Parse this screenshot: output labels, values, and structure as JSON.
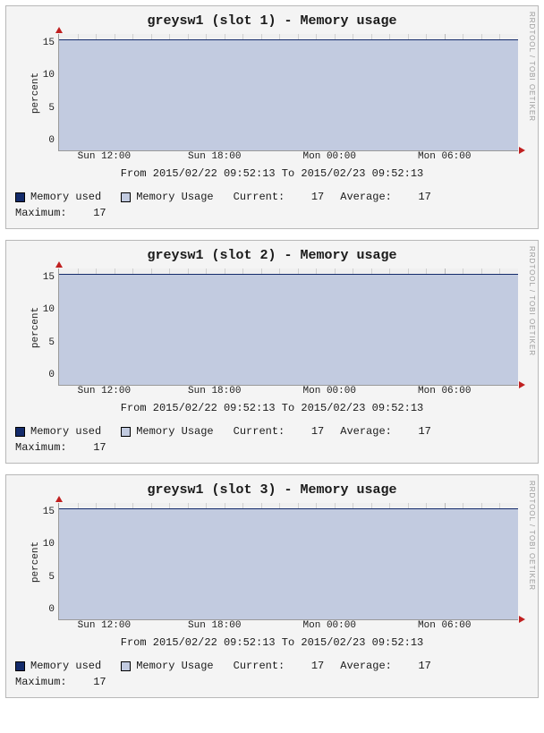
{
  "side_credit": "RRDTOOL / TOBI OETIKER",
  "panels": [
    {
      "title": "greysw1 (slot 1) - Memory usage",
      "ylabel": "percent",
      "yticks": [
        "0",
        "5",
        "10",
        "15"
      ],
      "xticks": [
        "Sun 12:00",
        "Sun 18:00",
        "Mon 00:00",
        "Mon 06:00"
      ],
      "caption": "From 2015/02/22 09:52:13 To 2015/02/23 09:52:13",
      "legend": {
        "used": "Memory used",
        "usage": "Memory Usage",
        "current_label": "Current:",
        "current_value": "17",
        "average_label": "Average:",
        "average_value": "17",
        "maximum_label": "Maximum:",
        "maximum_value": "17"
      }
    },
    {
      "title": "greysw1 (slot 2) - Memory usage",
      "ylabel": "percent",
      "yticks": [
        "0",
        "5",
        "10",
        "15"
      ],
      "xticks": [
        "Sun 12:00",
        "Sun 18:00",
        "Mon 00:00",
        "Mon 06:00"
      ],
      "caption": "From 2015/02/22 09:52:13 To 2015/02/23 09:52:13",
      "legend": {
        "used": "Memory used",
        "usage": "Memory Usage",
        "current_label": "Current:",
        "current_value": "17",
        "average_label": "Average:",
        "average_value": "17",
        "maximum_label": "Maximum:",
        "maximum_value": "17"
      }
    },
    {
      "title": "greysw1 (slot 3) - Memory usage",
      "ylabel": "percent",
      "yticks": [
        "0",
        "5",
        "10",
        "15"
      ],
      "xticks": [
        "Sun 12:00",
        "Sun 18:00",
        "Mon 00:00",
        "Mon 06:00"
      ],
      "caption": "From 2015/02/22 09:52:13 To 2015/02/23 09:52:13",
      "legend": {
        "used": "Memory used",
        "usage": "Memory Usage",
        "current_label": "Current:",
        "current_value": "17",
        "average_label": "Average:",
        "average_value": "17",
        "maximum_label": "Maximum:",
        "maximum_value": "17"
      }
    }
  ],
  "chart_data": [
    {
      "type": "area",
      "title": "greysw1 (slot 1) - Memory usage",
      "xlabel": "",
      "ylabel": "percent",
      "ylim": [
        0,
        18
      ],
      "x": [
        "2015-02-22 09:52:13",
        "2015-02-22 12:00",
        "2015-02-22 18:00",
        "2015-02-23 00:00",
        "2015-02-23 06:00",
        "2015-02-23 09:52:13"
      ],
      "series": [
        {
          "name": "Memory Usage",
          "values": [
            17,
            17,
            17,
            17,
            17,
            17
          ]
        }
      ],
      "stats": {
        "current": 17,
        "average": 17,
        "maximum": 17
      }
    },
    {
      "type": "area",
      "title": "greysw1 (slot 2) - Memory usage",
      "xlabel": "",
      "ylabel": "percent",
      "ylim": [
        0,
        18
      ],
      "x": [
        "2015-02-22 09:52:13",
        "2015-02-22 12:00",
        "2015-02-22 18:00",
        "2015-02-23 00:00",
        "2015-02-23 06:00",
        "2015-02-23 09:52:13"
      ],
      "series": [
        {
          "name": "Memory Usage",
          "values": [
            17,
            17,
            17,
            17,
            17,
            17
          ]
        }
      ],
      "stats": {
        "current": 17,
        "average": 17,
        "maximum": 17
      }
    },
    {
      "type": "area",
      "title": "greysw1 (slot 3) - Memory usage",
      "xlabel": "",
      "ylabel": "percent",
      "ylim": [
        0,
        18
      ],
      "x": [
        "2015-02-22 09:52:13",
        "2015-02-22 12:00",
        "2015-02-22 18:00",
        "2015-02-23 00:00",
        "2015-02-23 06:00",
        "2015-02-23 09:52:13"
      ],
      "series": [
        {
          "name": "Memory Usage",
          "values": [
            17,
            17,
            17,
            17,
            17,
            17
          ]
        }
      ],
      "stats": {
        "current": 17,
        "average": 17,
        "maximum": 17
      }
    }
  ]
}
